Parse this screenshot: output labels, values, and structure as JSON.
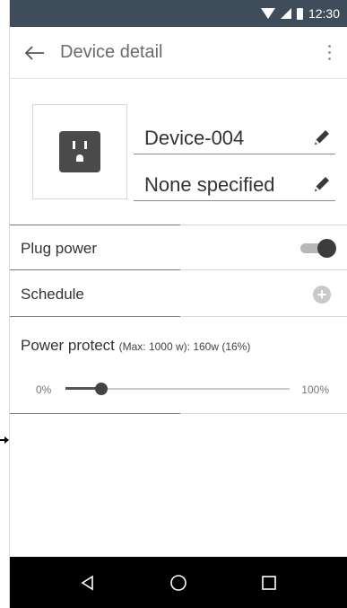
{
  "statusbar": {
    "time": "12:30",
    "icons": [
      "wifi-icon",
      "signal-icon",
      "battery-icon"
    ]
  },
  "appbar": {
    "back_icon": "back-arrow-icon",
    "title": "Device detail",
    "menu_icon": "more-vert-icon"
  },
  "device": {
    "icon": "power-outlet-icon",
    "name": "Device-004",
    "location": "None specified",
    "edit_icon": "pencil-icon"
  },
  "settings": {
    "plug_power": {
      "label": "Plug power",
      "enabled": true
    },
    "schedule": {
      "label": "Schedule",
      "add_icon": "add-circle-icon"
    },
    "power_protect": {
      "label": "Power protect",
      "detail": "(Max: 1000 w):  160w (16%)",
      "min_label": "0%",
      "max_label": "100%",
      "value_fraction": 0.16
    }
  },
  "navbar": {
    "icons": [
      "back-triangle-icon",
      "home-circle-icon",
      "recents-square-icon"
    ]
  },
  "colors": {
    "statusbar": "#3f4d5a",
    "accent": "#3c3c3c",
    "navbar": "#000000"
  }
}
